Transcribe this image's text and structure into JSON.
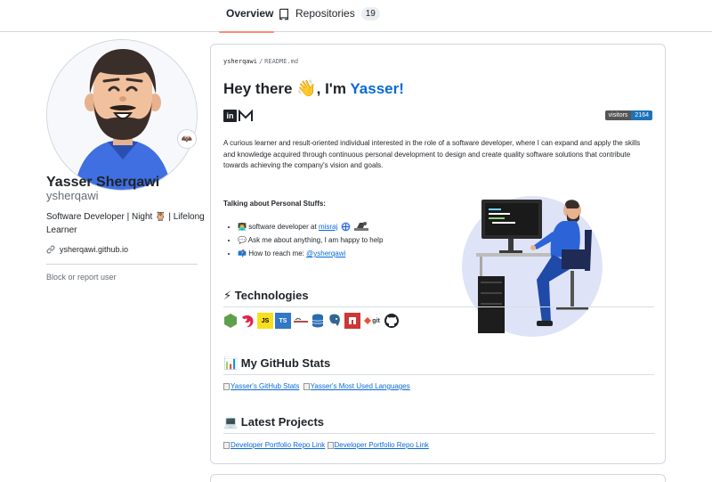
{
  "tabs": [
    {
      "label": "Overview",
      "icon": "book-icon",
      "active": true
    },
    {
      "label": "Repositories",
      "icon": "repo-icon",
      "count": "19"
    }
  ],
  "profile": {
    "full_name": "Yasser Sherqawi",
    "username": "ysherqawi",
    "bio": "Software Developer | Night 🦉 | Lifelong Learner",
    "website": "ysherqawi.github.io",
    "block_link": "Block or report user",
    "status_emoji": "🦇"
  },
  "readme": {
    "path_user": "ysherqawi",
    "path_sep": "/",
    "path_file": "README.md",
    "greeting_prefix": "Hey there",
    "wave": "👋",
    "greeting_mid": ", I'm",
    "greeting_name": "Yasser!",
    "visitors_label": "visitors",
    "visitors_count": "2164",
    "intro": "A curious learner and result-oriented individual interested in the role of a software developer, where I can expand and apply the skills and knowledge acquired through continuous personal development to design and create quality software solutions that contribute towards achieving the company's vision and goals.",
    "talking_heading": "Talking about Personal Stuffs:",
    "bullets": {
      "b1_emoji": "👨‍💻",
      "b1_text": "software developer at",
      "b1_link": "misraj",
      "b2_emoji": "💬",
      "b2_text": "Ask me about anything, I am happy to help",
      "b3_emoji": "📫",
      "b3_text": "How to reach me:",
      "b3_link": "@ysherqawi"
    },
    "technologies_heading": "⚡ Technologies",
    "tech_icons": [
      "nodejs-icon",
      "nestjs-icon",
      "javascript-icon",
      "typescript-icon",
      "mongoose-icon",
      "database-icon",
      "postgresql-icon",
      "npm-icon",
      "git-icon",
      "github-icon"
    ],
    "tech_labels": {
      "js": "JS",
      "ts": "TS",
      "git": "git"
    },
    "stats_heading": "📊 My GitHub Stats",
    "stats_link1": "Yasser's GitHub Stats",
    "stats_link2": "Yasser's Most Used Languages",
    "projects_heading": "💻 Latest Projects",
    "project_link1": "Developer Portfolio Repo Link",
    "project_link2": "Developer Portfolio Repo Link"
  },
  "colors": {
    "accent_link": "#0969da",
    "tab_underline": "#fd8c73",
    "visitors_badge": "#1f72b8",
    "illustration_circle": "#dfe3f7",
    "shirt_blue": "#2c64d8"
  }
}
